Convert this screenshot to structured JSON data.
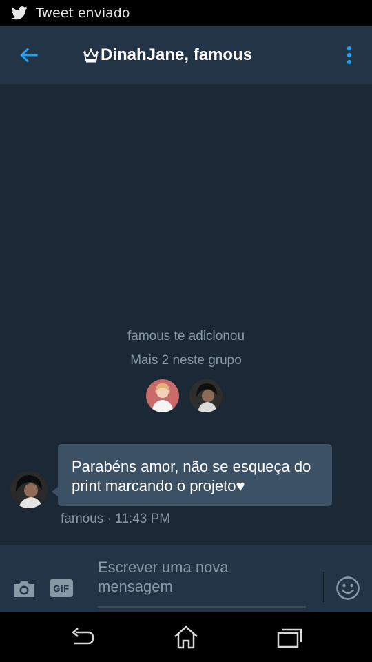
{
  "status_bar": {
    "notification": "Tweet enviado",
    "icon": "twitter-bird-icon"
  },
  "header": {
    "title": "DinahJane, famous",
    "title_icon": "crown-icon",
    "back_icon": "arrow-left-icon",
    "menu_icon": "more-vertical-icon"
  },
  "conversation": {
    "system_message": "famous te adicionou",
    "group_info": "Mais 2 neste grupo",
    "members": [
      "member-avatar",
      "member-avatar"
    ],
    "messages": [
      {
        "text": "Parabéns amor, não se esqueça do print marcando o projeto♥",
        "sender": "famous",
        "time": "11:43 PM",
        "meta": "famous · 11:43 PM"
      }
    ]
  },
  "composer": {
    "placeholder": "Escrever uma nova mensagem",
    "value": "",
    "gif_label": "GIF",
    "camera_icon": "camera-icon",
    "emoji_icon": "smiley-icon"
  },
  "nav_bar": {
    "buttons": [
      "back-icon",
      "home-icon",
      "recents-icon"
    ]
  },
  "colors": {
    "accent": "#1da1f2",
    "app_bar": "#243447",
    "background": "#1b2836",
    "bubble": "#3d5164",
    "muted_text": "#8899a6"
  }
}
